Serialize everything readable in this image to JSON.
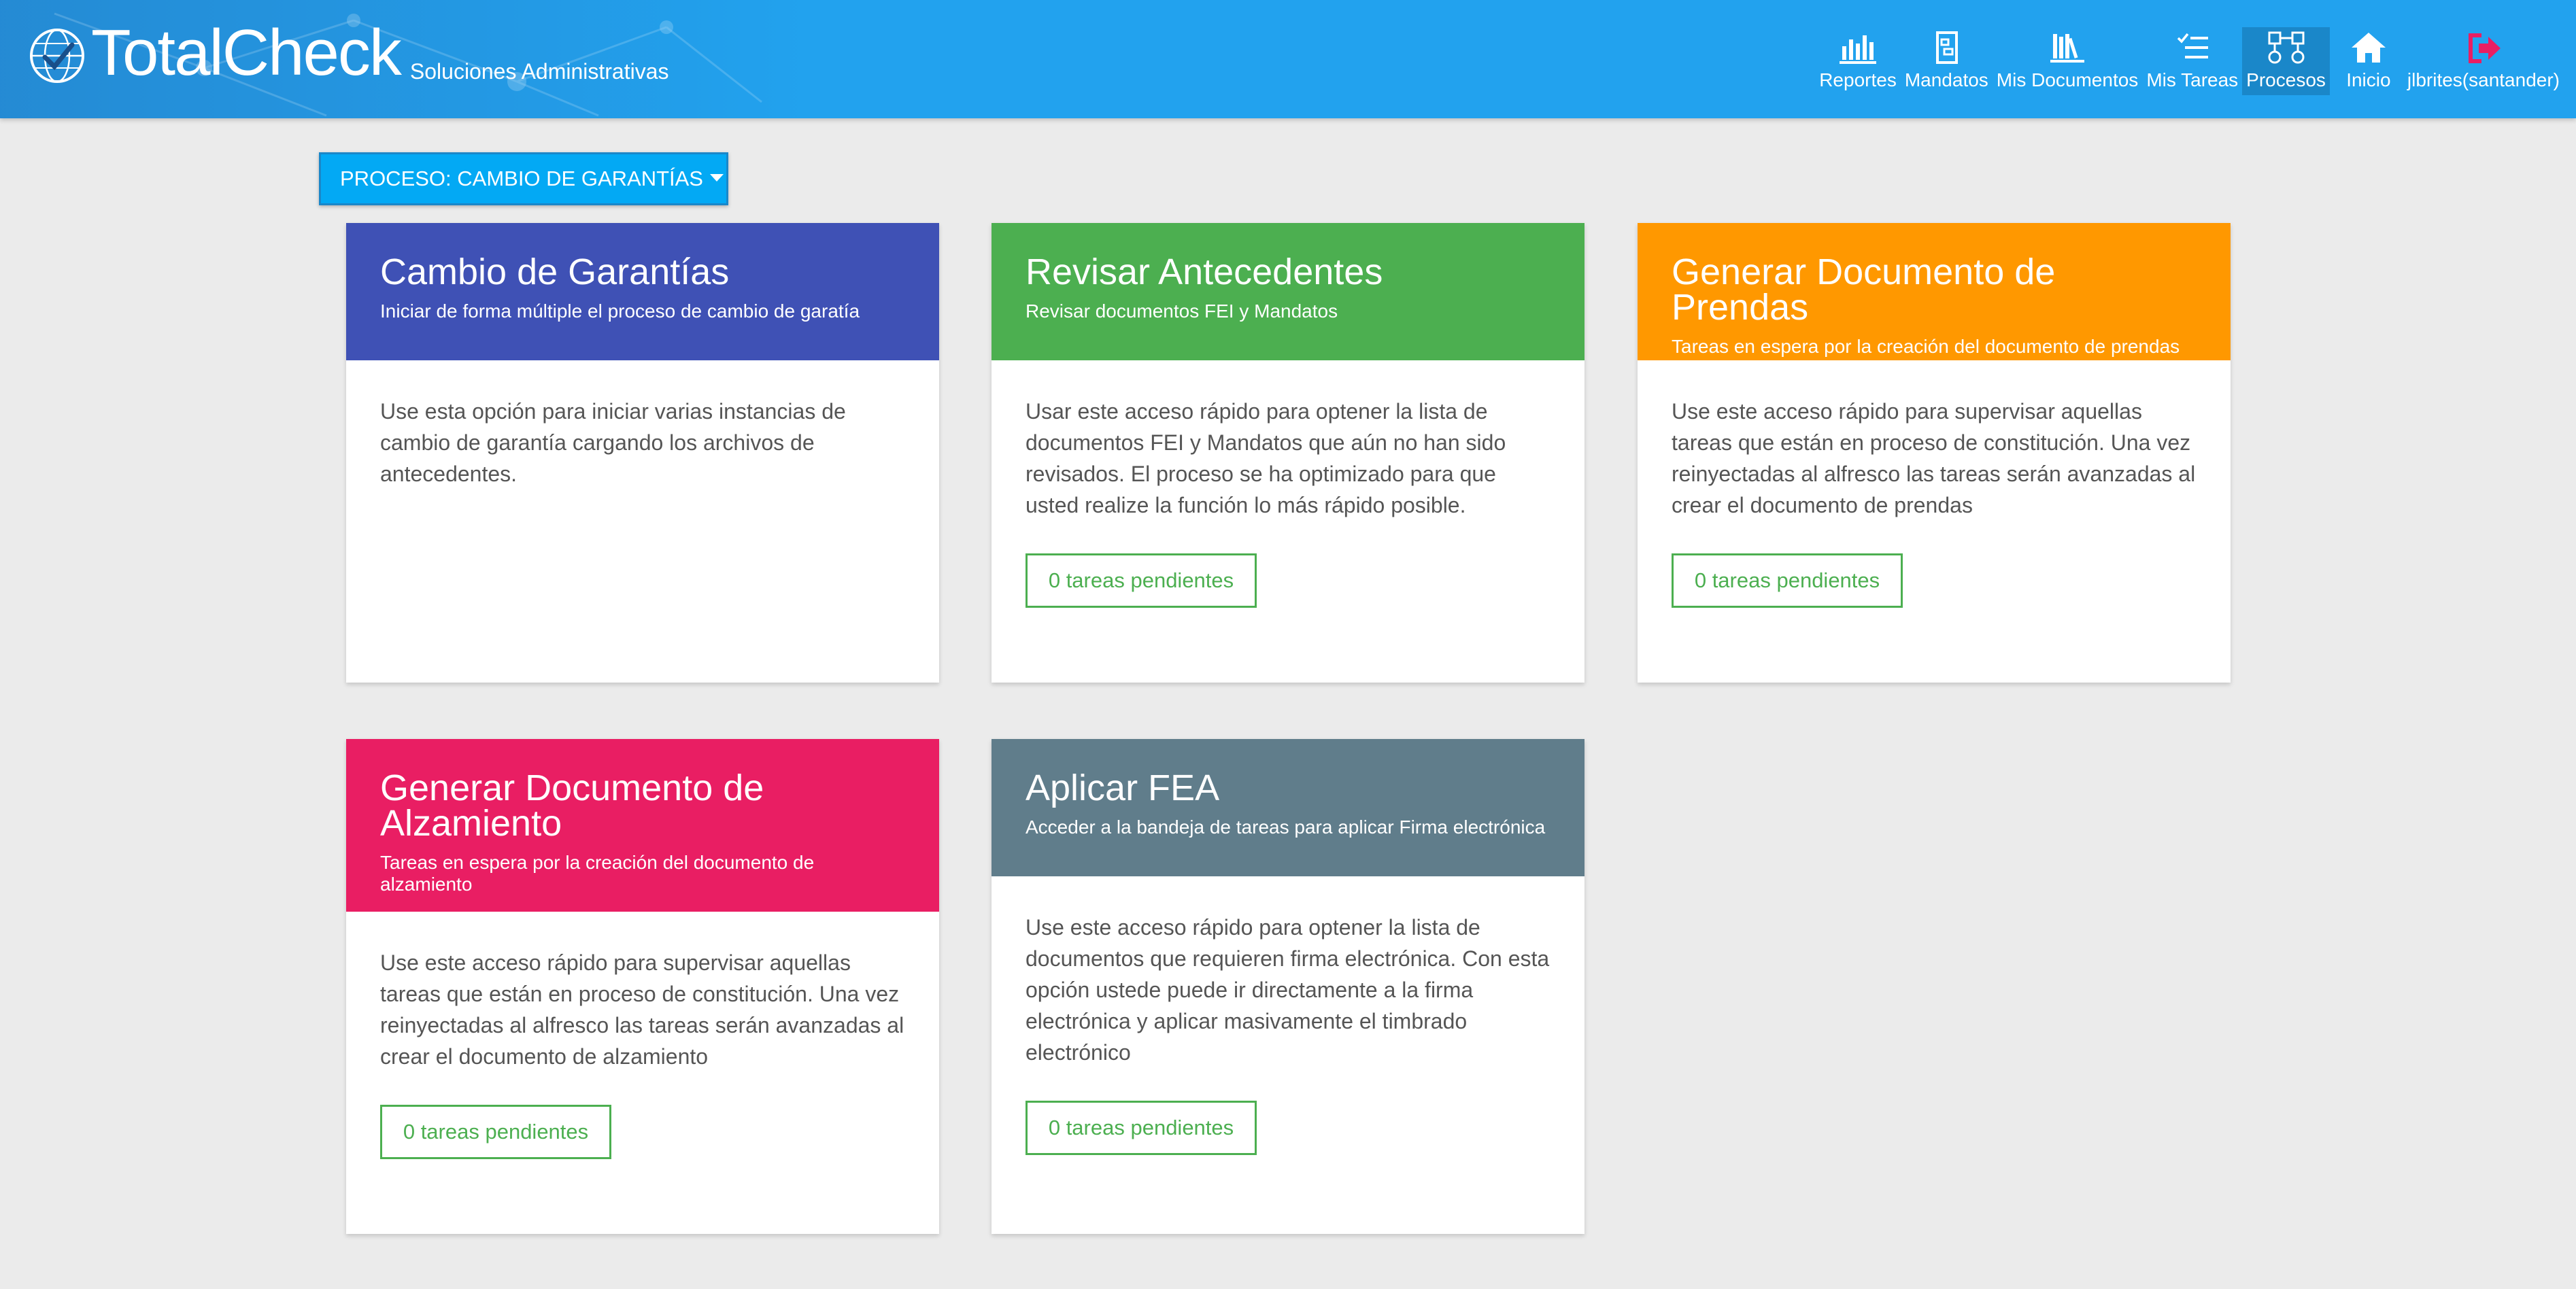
{
  "brand": {
    "name": "TotalCheck",
    "tagline": "Soluciones Administrativas"
  },
  "nav": [
    {
      "label": "Reportes",
      "icon": "bar-chart-icon"
    },
    {
      "label": "Mandatos",
      "icon": "document-icon"
    },
    {
      "label": "Mis Documentos",
      "icon": "books-icon"
    },
    {
      "label": "Mis Tareas",
      "icon": "task-list-icon"
    },
    {
      "label": "Procesos",
      "icon": "process-flow-icon",
      "active": true
    },
    {
      "label": "Inicio",
      "icon": "home-icon"
    },
    {
      "label": "jlbrites(santander)",
      "icon": "logout-icon"
    }
  ],
  "process_selector": {
    "label": "PROCESO: CAMBIO DE GARANTÍAS"
  },
  "cards": [
    {
      "title": "Cambio de Garantías",
      "subtitle": "Iniciar de forma múltiple el proceso de cambio de garatía",
      "body": "Use esta opción para iniciar varias instancias de cambio de garantía cargando los archivos de antecedentes.",
      "color": "#3f51b5"
    },
    {
      "title": "Revisar Antecedentes",
      "subtitle": "Revisar documentos FEI y Mandatos",
      "body": "Usar este acceso rápido para optener la lista de documentos FEI y Mandatos que aún no han sido revisados. El proceso se ha optimizado para que usted realize la función lo más rápido posible.",
      "button": "0 tareas pendientes",
      "color": "#4caf50"
    },
    {
      "title": "Generar Documento de Prendas",
      "subtitle": "Tareas en espera por la creación del documento de prendas",
      "body": "Use este acceso rápido para supervisar aquellas tareas que están en proceso de constitución. Una vez reinyectadas al alfresco las tareas serán avanzadas al crear el documento de prendas",
      "button": "0 tareas pendientes",
      "color": "#ff9800"
    },
    {
      "title": "Generar Documento de Alzamiento",
      "subtitle": "Tareas en espera por la creación del documento de alzamiento",
      "body": "Use este acceso rápido para supervisar aquellas tareas que están en proceso de constitución. Una vez reinyectadas al alfresco las tareas serán avanzadas al crear el documento de alzamiento",
      "button": "0 tareas pendientes",
      "color": "#e91e63"
    },
    {
      "title": "Aplicar FEA",
      "subtitle": "Acceder a la bandeja de tareas para aplicar Firma electrónica",
      "body": "Use este acceso rápido para optener la lista de documentos que requieren firma electrónica. Con esta opción ustede puede ir directamente a la firma electrónica y aplicar masivamente el timbrado electrónico",
      "button": "0 tareas pendientes",
      "color": "#607d8b"
    }
  ],
  "colors": {
    "header": "#22a2ee",
    "accent": "#03a9f4",
    "pending": "#4caf50",
    "logout": "#e91e63"
  }
}
